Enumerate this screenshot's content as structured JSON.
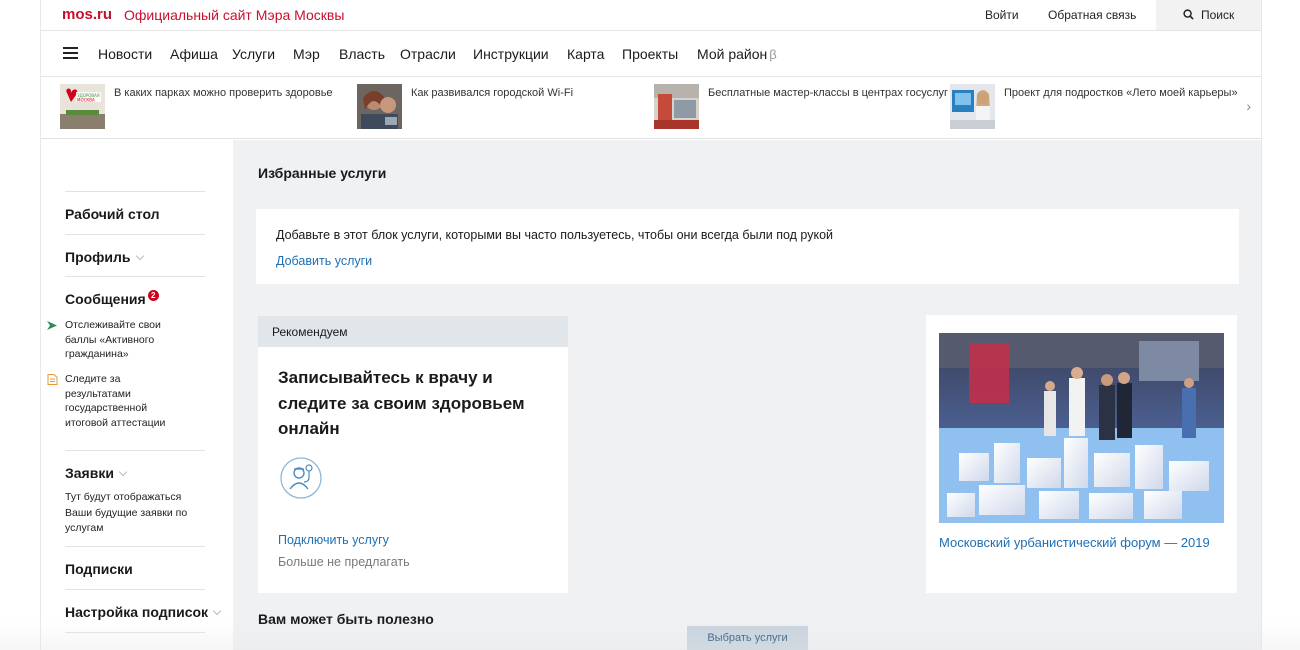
{
  "topbar": {
    "logo": "mos.ru",
    "site_title": "Официальный сайт Мэра Москвы",
    "login": "Войти",
    "feedback": "Обратная связь",
    "search": "Поиск"
  },
  "nav": {
    "items": [
      "Новости",
      "Афиша",
      "Услуги",
      "Мэр",
      "Власть",
      "Отрасли",
      "Инструкции",
      "Карта",
      "Проекты",
      "Мой район"
    ],
    "beta_mark": "β"
  },
  "news": [
    {
      "text": "В каких парках можно проверить здоровье",
      "thumb_label": "ЗДОРОВАЯ МОСКВА"
    },
    {
      "text": "Как развивался городской Wi-Fi"
    },
    {
      "text": "Бесплатные мастер-классы в центрах госуслуг"
    },
    {
      "text": "Проект для подростков «Лето моей карьеры»"
    }
  ],
  "sidebar": {
    "desktop": "Рабочий стол",
    "profile": "Профиль",
    "messages": "Сообщения",
    "messages_count": "2",
    "notes": [
      "Отслеживайте свои баллы «Активного гражданина»",
      "Следите за результатами государственной итоговой аттестации"
    ],
    "requests": "Заявки",
    "requests_note": "Тут будут отображаться Ваши будущие заявки по услугам",
    "subscriptions": "Подписки",
    "subscription_settings": "Настройка подписок"
  },
  "main": {
    "favorites_title": "Избранные услуги",
    "favorites_text": "Добавьте в этот блок услуги, которыми вы часто пользуетесь, чтобы они всегда были под рукой",
    "favorites_link": "Добавить услуги",
    "recommend_label": "Рекомендуем",
    "recommend_title": "Записывайтесь к врачу и следите за своим здоровьем онлайн",
    "recommend_link": "Подключить услугу",
    "recommend_dismiss": "Больше не предлагать",
    "promo_link": "Московский урбанистический форум — 2019",
    "useful_title": "Вам может быть полезно",
    "select_button": "Выбрать услуги"
  },
  "colors": {
    "brand_red": "#c8102e",
    "link_blue": "#1f6fb3",
    "badge_red": "#d0021b",
    "main_bg": "#f0f1f3"
  }
}
